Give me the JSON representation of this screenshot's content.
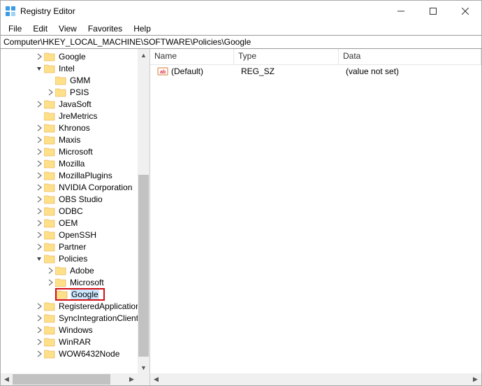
{
  "window": {
    "title": "Registry Editor"
  },
  "menu": {
    "file": "File",
    "edit": "Edit",
    "view": "View",
    "favorites": "Favorites",
    "help": "Help"
  },
  "address": {
    "path": "Computer\\HKEY_LOCAL_MACHINE\\SOFTWARE\\Policies\\Google"
  },
  "tree": {
    "items": [
      {
        "indent": 3,
        "exp": "right",
        "label": "Google"
      },
      {
        "indent": 3,
        "exp": "down",
        "label": "Intel"
      },
      {
        "indent": 4,
        "exp": "blank",
        "label": "GMM"
      },
      {
        "indent": 4,
        "exp": "right",
        "label": "PSIS"
      },
      {
        "indent": 3,
        "exp": "right",
        "label": "JavaSoft"
      },
      {
        "indent": 3,
        "exp": "blank",
        "label": "JreMetrics"
      },
      {
        "indent": 3,
        "exp": "right",
        "label": "Khronos"
      },
      {
        "indent": 3,
        "exp": "right",
        "label": "Maxis"
      },
      {
        "indent": 3,
        "exp": "right",
        "label": "Microsoft"
      },
      {
        "indent": 3,
        "exp": "right",
        "label": "Mozilla"
      },
      {
        "indent": 3,
        "exp": "right",
        "label": "MozillaPlugins"
      },
      {
        "indent": 3,
        "exp": "right",
        "label": "NVIDIA Corporation"
      },
      {
        "indent": 3,
        "exp": "right",
        "label": "OBS Studio"
      },
      {
        "indent": 3,
        "exp": "right",
        "label": "ODBC"
      },
      {
        "indent": 3,
        "exp": "right",
        "label": "OEM"
      },
      {
        "indent": 3,
        "exp": "right",
        "label": "OpenSSH"
      },
      {
        "indent": 3,
        "exp": "right",
        "label": "Partner"
      },
      {
        "indent": 3,
        "exp": "down",
        "label": "Policies"
      },
      {
        "indent": 4,
        "exp": "right",
        "label": "Adobe"
      },
      {
        "indent": 4,
        "exp": "right",
        "label": "Microsoft"
      },
      {
        "indent": 4,
        "exp": "blank",
        "label": "Google",
        "highlighted": true
      },
      {
        "indent": 3,
        "exp": "right",
        "label": "RegisteredApplications"
      },
      {
        "indent": 3,
        "exp": "right",
        "label": "SyncIntegrationClients"
      },
      {
        "indent": 3,
        "exp": "right",
        "label": "Windows"
      },
      {
        "indent": 3,
        "exp": "right",
        "label": "WinRAR"
      },
      {
        "indent": 3,
        "exp": "right",
        "label": "WOW6432Node"
      }
    ]
  },
  "columns": {
    "name": "Name",
    "type": "Type",
    "data": "Data"
  },
  "values": {
    "row0": {
      "name": "(Default)",
      "type": "REG_SZ",
      "data": "(value not set)"
    }
  }
}
